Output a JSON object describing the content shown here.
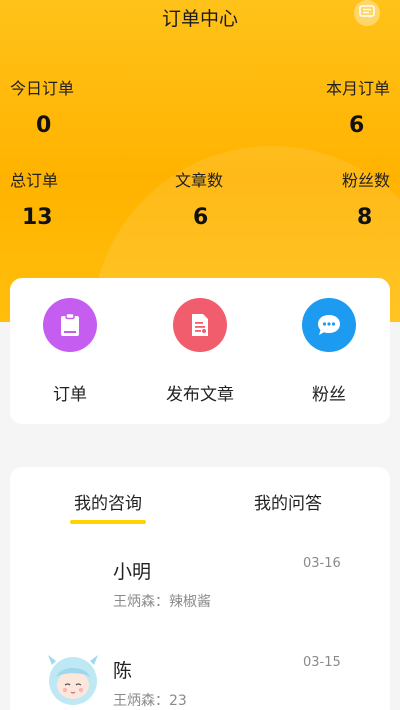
{
  "header": {
    "title": "订单中心"
  },
  "stats": {
    "today_label": "今日订单",
    "today_value": "0",
    "month_label": "本月订单",
    "month_value": "6",
    "total_label": "总订单",
    "total_value": "13",
    "articles_label": "文章数",
    "articles_value": "6",
    "fans_label": "粉丝数",
    "fans_value": "8"
  },
  "quick_actions": [
    {
      "label": "订单",
      "icon": "clipboard-icon",
      "color": "#c55df0"
    },
    {
      "label": "发布文章",
      "icon": "document-icon",
      "color": "#f25d6e"
    },
    {
      "label": "粉丝",
      "icon": "chat-bubble-icon",
      "color": "#1d9bf0"
    }
  ],
  "tabs": [
    {
      "label": "我的咨询",
      "active": true
    },
    {
      "label": "我的问答",
      "active": false
    }
  ],
  "consultations": [
    {
      "name": "小明",
      "subtitle": "王炳森：辣椒酱",
      "date": "03-16"
    },
    {
      "name": "陈",
      "subtitle": "王炳森：23",
      "date": "03-15"
    }
  ],
  "colors": {
    "accent": "#ffb800",
    "tab_indicator": "#ffd400"
  }
}
